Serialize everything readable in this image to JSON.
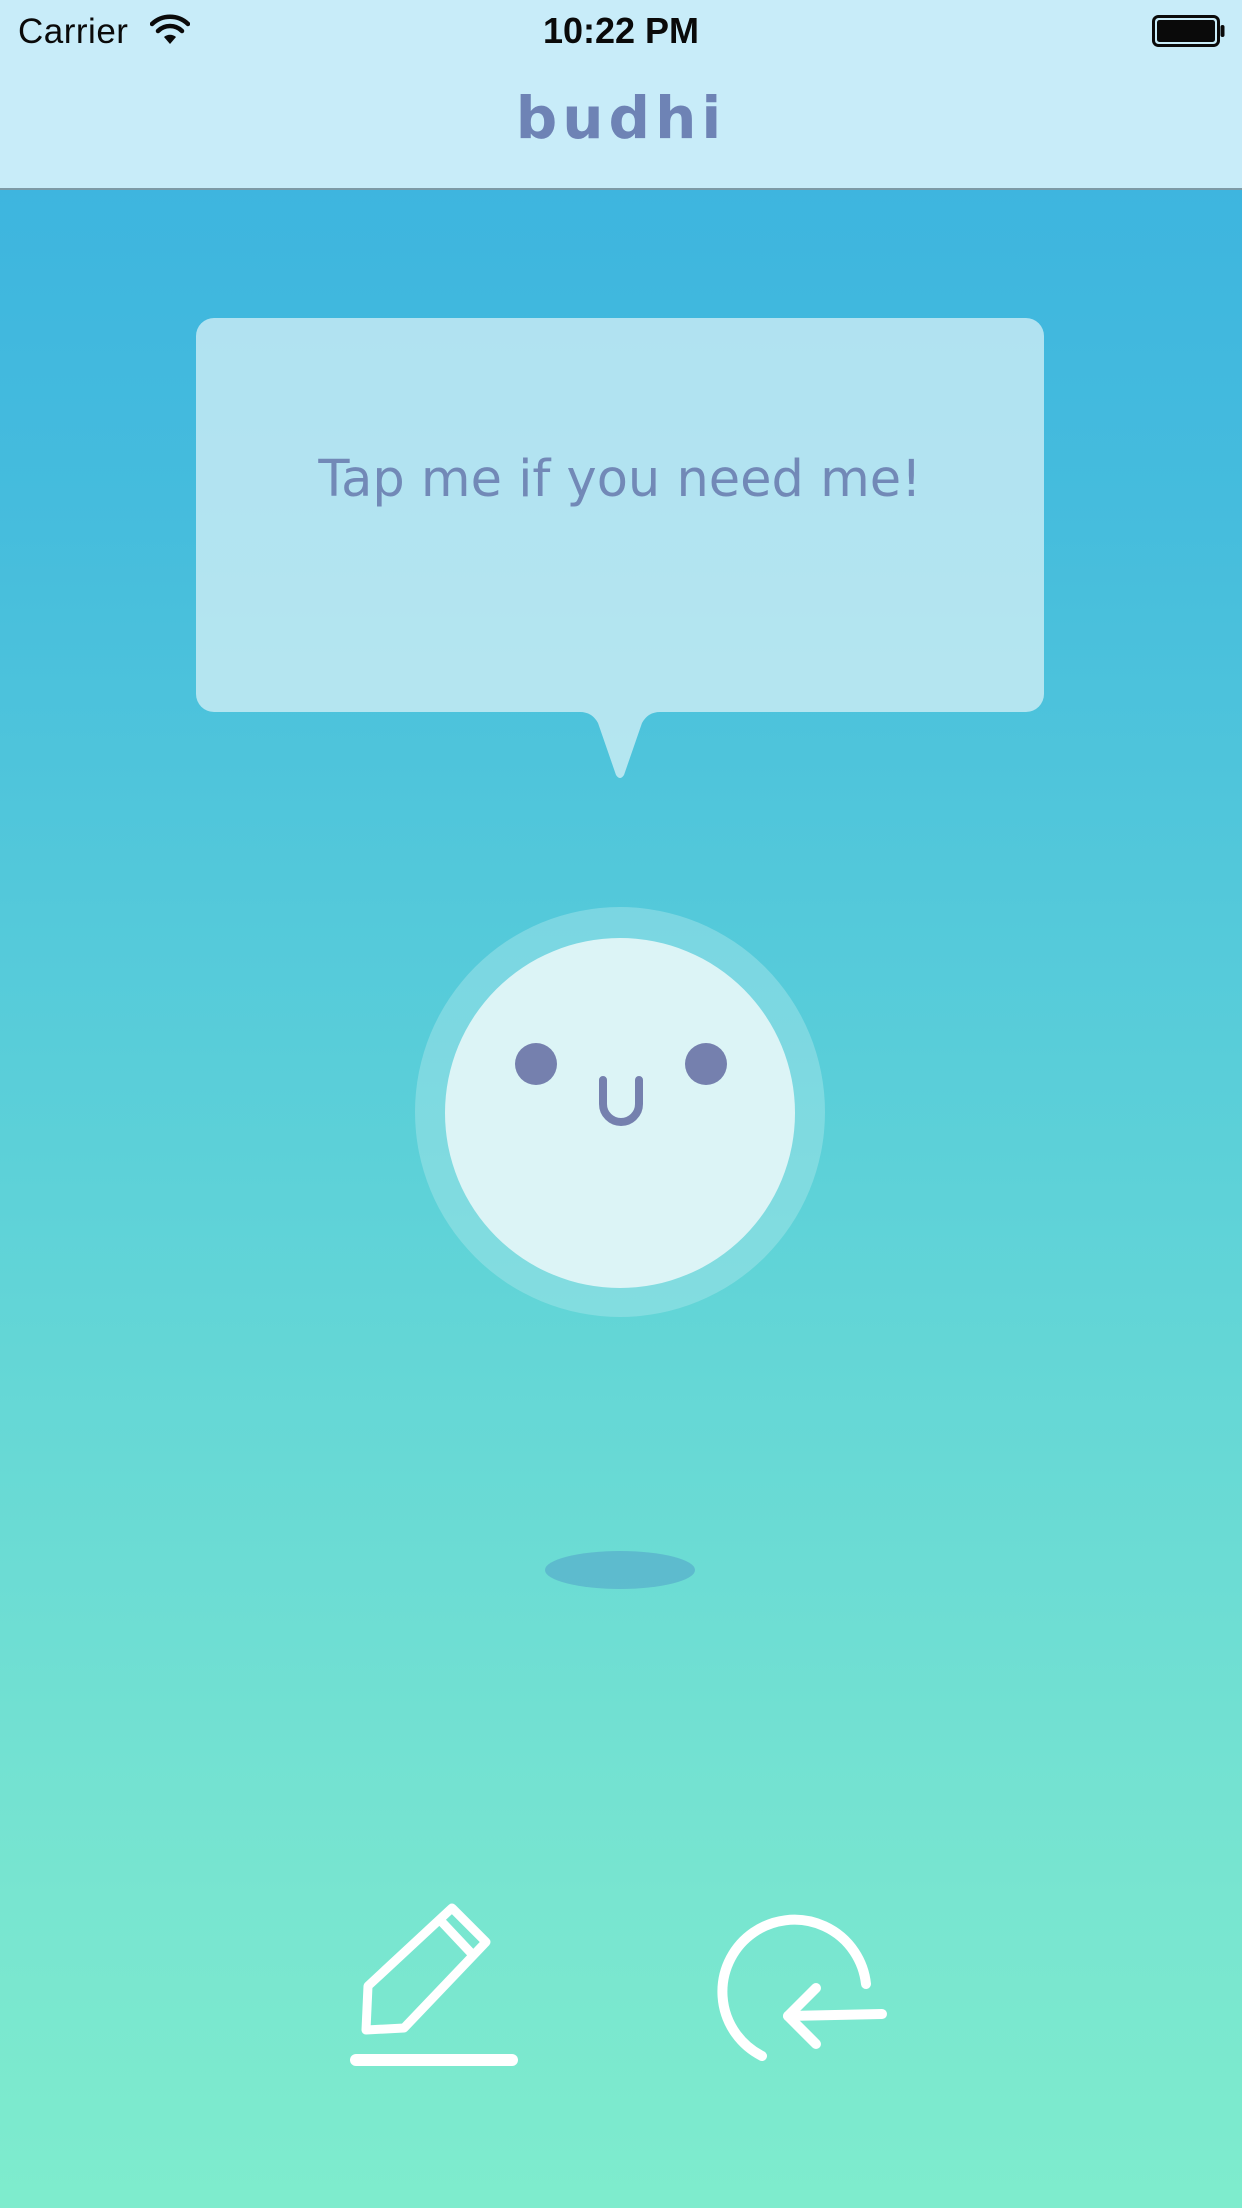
{
  "status_bar": {
    "carrier": "Carrier",
    "time": "10:22 PM",
    "wifi_icon": "wifi-icon",
    "battery_icon": "battery-full-icon"
  },
  "nav": {
    "title": "budhi"
  },
  "bubble": {
    "text": "Tap me if you need me!"
  },
  "character": {
    "expression": "smiling-face"
  },
  "actions": {
    "write_icon": "pencil-icon",
    "undo_icon": "undo-circle-arrow-icon"
  },
  "colors": {
    "accent": "#6e83b5",
    "bubble_text": "#7289b7",
    "face": "#dcf4f6",
    "eyes": "#7580ae",
    "gradient_top": "#39b1e0",
    "gradient_bottom": "#7eeccd"
  }
}
